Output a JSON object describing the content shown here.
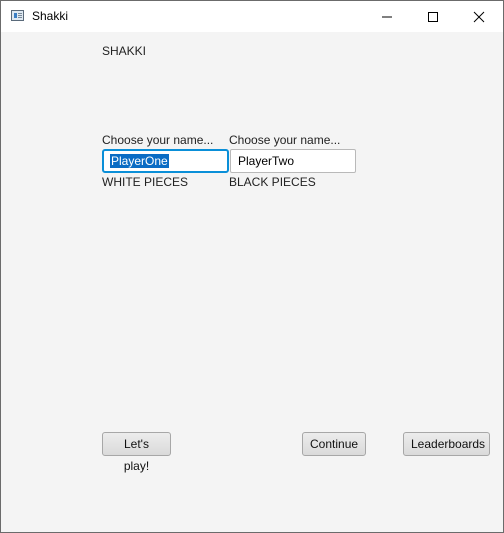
{
  "window": {
    "title": "Shakki"
  },
  "main": {
    "heading": "SHAKKI",
    "player_one": {
      "prompt": "Choose your name...",
      "value": "PlayerOne",
      "pieces": "WHITE PIECES"
    },
    "player_two": {
      "prompt": "Choose your name...",
      "value": "PlayerTwo",
      "pieces": "BLACK PIECES"
    }
  },
  "buttons": {
    "play": "Let's play!",
    "continue": "Continue",
    "leaderboards": "Leaderboards"
  },
  "colors": {
    "focus_border": "#0a8fd8",
    "selection": "#0a6cc4",
    "background": "#f4f4f4"
  }
}
